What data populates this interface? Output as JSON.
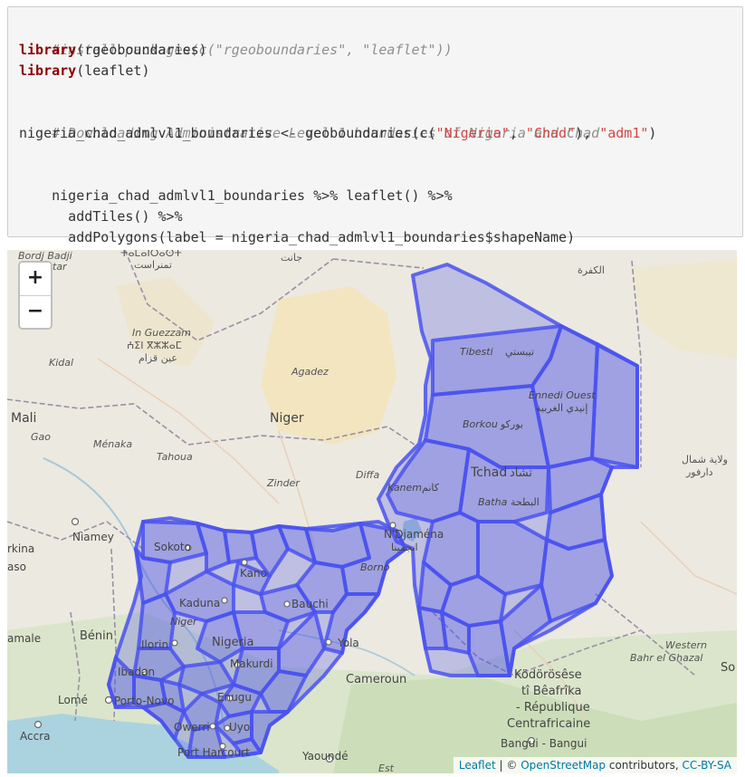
{
  "code": {
    "line1": "#install.packages(c(\"rgeoboundaries\", \"leaflet\"))",
    "library_kw": "library",
    "lib1_arg": "(rgeoboundaries)",
    "lib2_arg": "(leaflet)",
    "comment": "# Downloading Administrative Level 1 boundaries of Nigeria and Chad",
    "assign_prefix": "nigeria_chad_admlvl1_boundaries <- geoboundaries(c(",
    "str_nigeria": "\"Nigeria\"",
    "comma": ", ",
    "str_chad": "\"Chad\"",
    "mid_close": "), ",
    "str_adm1": "\"adm1\"",
    "close_paren": ")",
    "pipe_line1": "nigeria_chad_admlvl1_boundaries %>% leaflet() %>%",
    "pipe_line2": "  addTiles() %>%",
    "pipe_line3": "  addPolygons(label = nigeria_chad_admlvl1_boundaries$shapeName)"
  },
  "map": {
    "zoom_in": "+",
    "zoom_out": "−",
    "attribution": {
      "leaflet": "Leaflet",
      "sep": " | © ",
      "osm": "OpenStreetMap",
      "contributors": " contributors, ",
      "license": "CC-BY-SA"
    },
    "labels": {
      "bordj_badji": "Bordj Badji",
      "tar": "tar",
      "tamanrasset_tif": "ⵜⴰⵎⴰⵏⵔⴰⵙⵜ",
      "tamanrasset_ar": "تمنراست",
      "janet_ar": "جانت",
      "kufra_ar": "الكفرة",
      "in_guezzam": "In Guezzam",
      "in_guezzam_tif": "ⵄⵉⵏ ⴳⵣⵣⴰⵎ",
      "in_guezzam_ar": "عين قزام",
      "kidal": "Kidal",
      "agadez": "Agadez",
      "tibesti": "Tibesti",
      "tibesti_ar": "تيبستي",
      "ennedi": "Ennedi Ouest",
      "ennedi_ar": "إنيدي الغربية",
      "mali": "Mali",
      "niger": "Niger",
      "gao": "Gao",
      "menaka": "Ménaka",
      "tahoua": "Tahoua",
      "borkou": "Borkou",
      "borkou_ar": "بوركو",
      "north_darfur": "ولاية شمال",
      "darfur": "دارفور",
      "diffa": "Diffa",
      "zinder": "Zinder",
      "tchad": "Tchad",
      "tchad_ar": "تشاد",
      "kanem": "Kanem",
      "kanem_ar": "كانم",
      "batha": "Batha",
      "batha_ar": "البطحة",
      "niamey": "Niamey",
      "sokoto": "Sokoto",
      "kano": "Kano",
      "ndjamena": "N'Djaména",
      "ndjamena_ar": "انجمينا",
      "borno": "Borno",
      "rkina": "rkina",
      "aso": "aso",
      "kaduna": "Kaduna",
      "bauchi": "Bauchi",
      "niger_state": "Niger",
      "amale": "amale",
      "benin": "Bénin",
      "ilorin": "Ilorin",
      "nigeria": "Nigeria",
      "yola": "Yola",
      "ibadan": "Ibadan",
      "makurdi": "Makurdi",
      "cameroun": "Cameroun",
      "lome": "Lomé",
      "porto_novo": "Porto-Novo",
      "enugu": "Enugu",
      "owerri": "Owerri",
      "uyo": "Uyo",
      "accra": "Accra",
      "port_harcourt": "Port Harcourt",
      "yaounde": "Yaoundé",
      "kodorosese": "Ködörösêse",
      "ti_beafrika": "tî Bêafrîka",
      "republique": "- République",
      "centrafricaine": "Centrafricaine",
      "bangui": "Bangui - Bangui",
      "est": "Est",
      "western": "Western",
      "bahr_el_ghazal": "Bahr el Ghazal",
      "so": "So"
    }
  }
}
